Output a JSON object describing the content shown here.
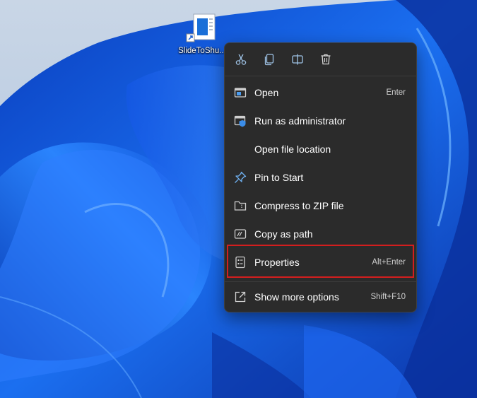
{
  "desktop": {
    "shortcut_label": "SlideToShu...",
    "icon": "shortcut-file-icon"
  },
  "context_menu": {
    "toolbar": [
      {
        "name": "cut",
        "icon": "scissors-icon"
      },
      {
        "name": "copy",
        "icon": "copy-icon"
      },
      {
        "name": "rename",
        "icon": "rename-icon"
      },
      {
        "name": "delete",
        "icon": "trash-icon"
      }
    ],
    "items": [
      {
        "label": "Open",
        "shortcut": "Enter",
        "icon": "open-window-icon"
      },
      {
        "label": "Run as administrator",
        "shortcut": "",
        "icon": "shield-window-icon"
      },
      {
        "label": "Open file location",
        "shortcut": "",
        "icon": ""
      },
      {
        "label": "Pin to Start",
        "shortcut": "",
        "icon": "pin-icon"
      },
      {
        "label": "Compress to ZIP file",
        "shortcut": "",
        "icon": "zip-folder-icon"
      },
      {
        "label": "Copy as path",
        "shortcut": "",
        "icon": "copy-path-icon"
      },
      {
        "label": "Properties",
        "shortcut": "Alt+Enter",
        "icon": "properties-icon"
      },
      {
        "label": "Show more options",
        "shortcut": "Shift+F10",
        "icon": "more-options-icon"
      }
    ],
    "highlighted_item": "Properties"
  },
  "colors": {
    "menu_bg": "#2b2b2b",
    "highlight": "#d31e1e",
    "accent": "#1a73e8"
  }
}
